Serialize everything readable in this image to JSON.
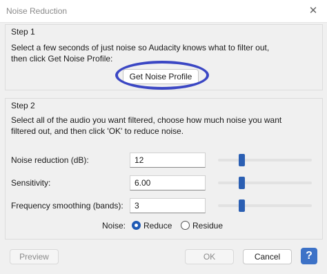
{
  "window": {
    "title": "Noise Reduction",
    "close_glyph": "✕"
  },
  "step1": {
    "legend": "Step 1",
    "line1": "Select a few seconds of just noise so Audacity knows what to filter out,",
    "line2": "then click Get Noise Profile:",
    "button": "Get Noise Profile"
  },
  "step2": {
    "legend": "Step 2",
    "line1": "Select all of the audio you want filtered, choose how much noise you want",
    "line2": "filtered out, and then click 'OK' to reduce noise.",
    "rows": [
      {
        "label": "Noise reduction (dB):",
        "value": "12",
        "slider_fraction": 0.25
      },
      {
        "label": "Sensitivity:",
        "value": "6.00",
        "slider_fraction": 0.25
      },
      {
        "label": "Frequency smoothing (bands):",
        "value": "3",
        "slider_fraction": 0.25
      }
    ],
    "noise": {
      "label": "Noise:",
      "options": [
        {
          "label": "Reduce",
          "checked": true
        },
        {
          "label": "Residue",
          "checked": false
        }
      ]
    }
  },
  "footer": {
    "preview": "Preview",
    "ok": "OK",
    "cancel": "Cancel",
    "help": "?"
  },
  "colors": {
    "annotation_oval": "#3b47c4",
    "slider_thumb": "#2b5fb3",
    "help_button": "#3d72c7"
  }
}
